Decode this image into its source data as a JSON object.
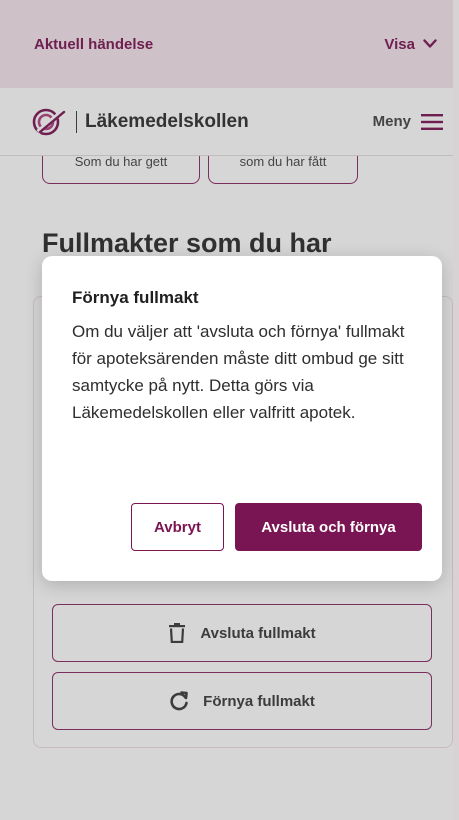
{
  "alert": {
    "title": "Aktuell händelse",
    "toggle_label": "Visa"
  },
  "header": {
    "logo_text": "Läkemedelskollen",
    "menu_label": "Meny"
  },
  "filters": {
    "chip_given": "Som du har gett",
    "chip_received": "som du har fått"
  },
  "section": {
    "title": "Fullmakter som du har"
  },
  "card_actions": {
    "end_label": "Avsluta fullmakt",
    "renew_label": "Förnya fullmakt"
  },
  "dialog": {
    "title": "Förnya fullmakt",
    "body": "Om du väljer att 'avsluta och förnya' fullmakt för apoteksärenden måste ditt ombud ge sitt samtycke på nytt. Detta görs via Läkemedelskollen eller valfritt apotek.",
    "cancel_label": "Avbryt",
    "confirm_label": "Avsluta och förnya"
  },
  "colors": {
    "brand": "#7a1553",
    "alert_bg": "#f5e6ee"
  }
}
